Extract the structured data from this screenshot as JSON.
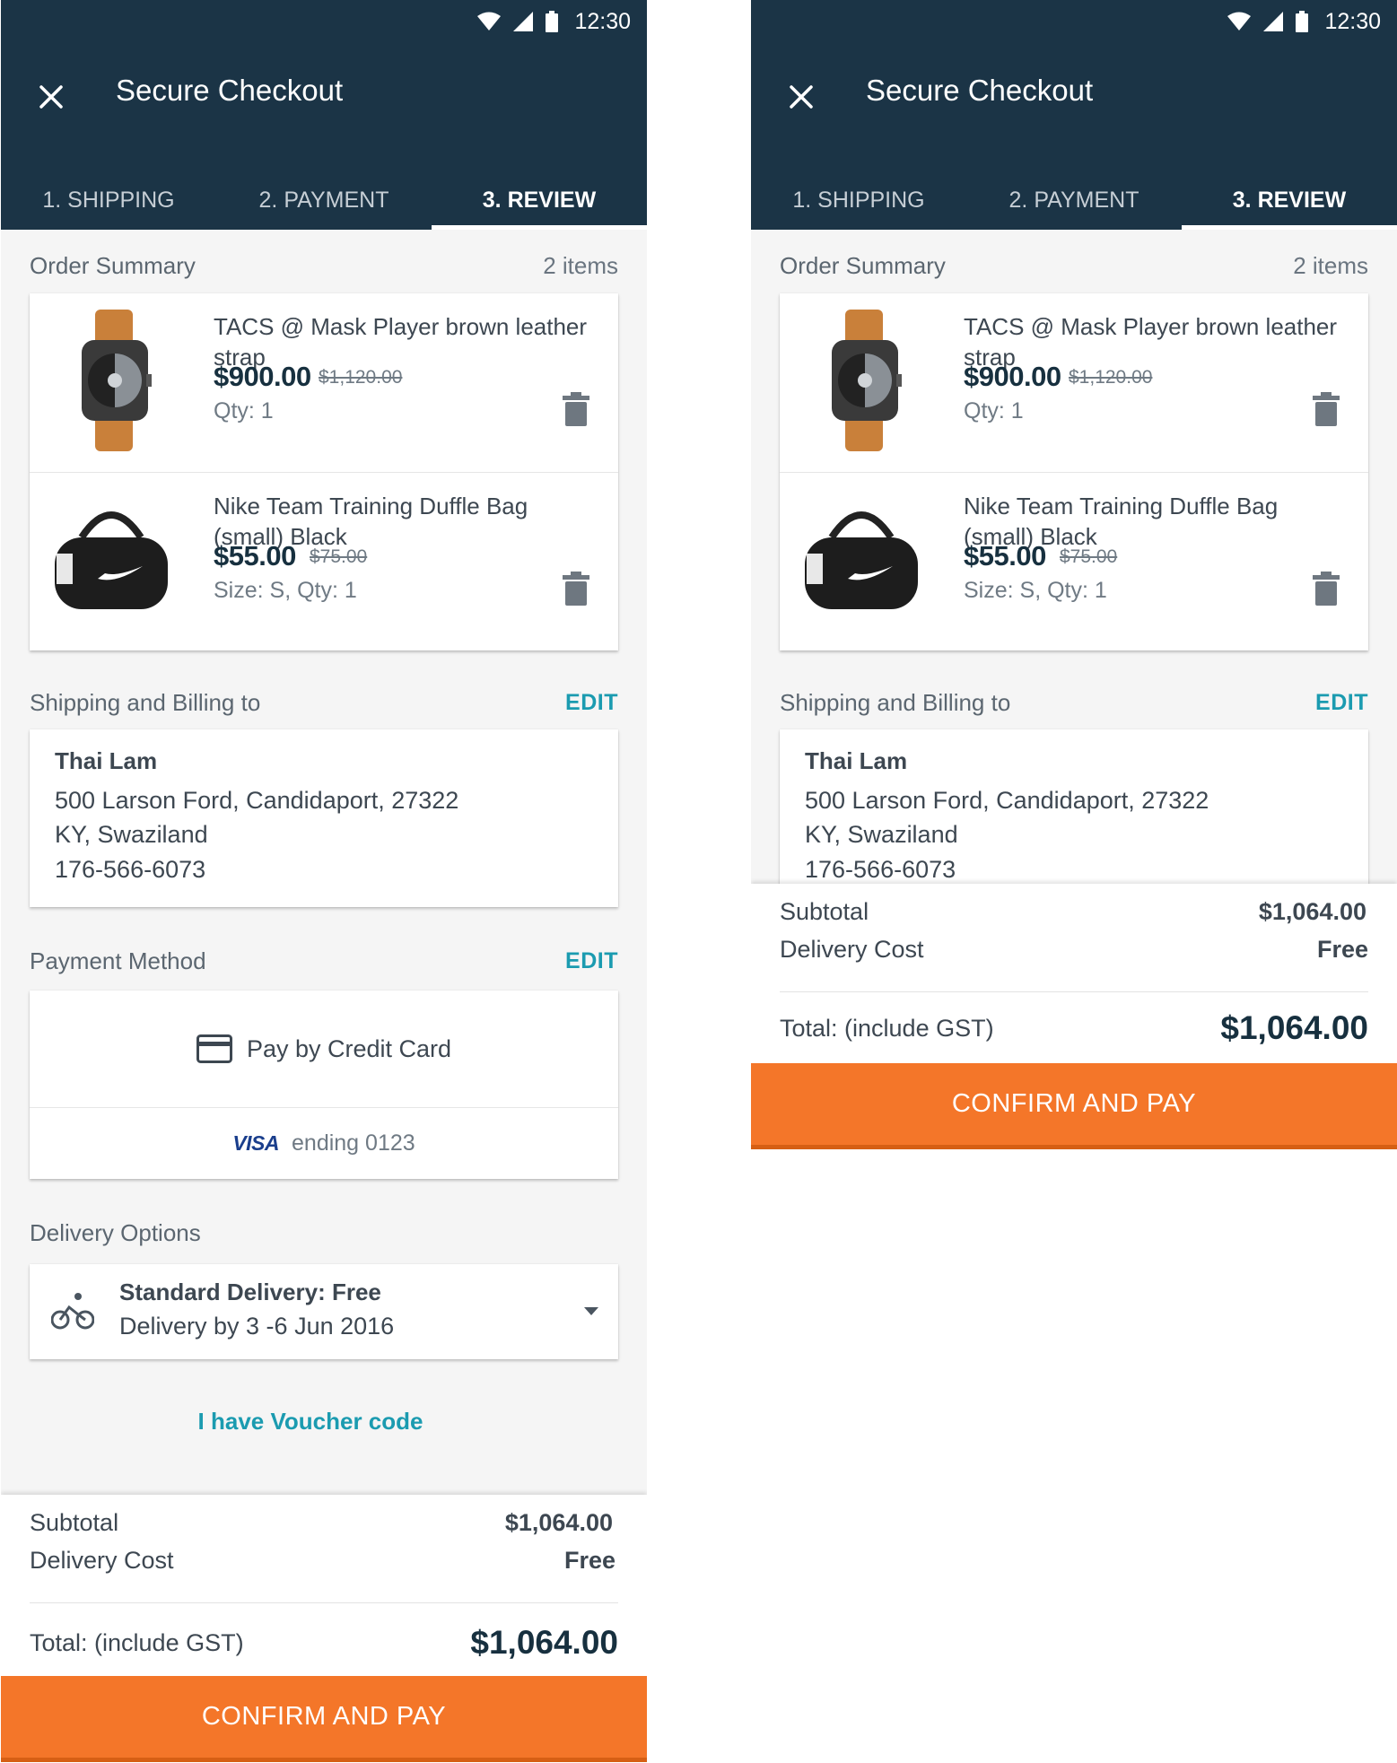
{
  "status_bar": {
    "time": "12:30"
  },
  "app_bar": {
    "title": "Secure Checkout"
  },
  "tabs": [
    {
      "label": "1. SHIPPING"
    },
    {
      "label": "2. PAYMENT"
    },
    {
      "label": "3. REVIEW",
      "active": true
    }
  ],
  "order_summary": {
    "title": "Order Summary",
    "count": "2 items",
    "items": [
      {
        "name": "TACS @ Mask Player brown leather strap",
        "price": "$900.00",
        "old_price": "$1,120.00",
        "details": "Qty: 1",
        "image_icon": "watch-image"
      },
      {
        "name": "Nike Team Training Duffle Bag (small) Black",
        "price": "$55.00",
        "old_price": "$75.00",
        "details": "Size: S, Qty: 1",
        "image_icon": "duffle-bag-image"
      }
    ]
  },
  "shipping": {
    "title": "Shipping and Billing to",
    "edit_label": "EDIT",
    "name": "Thai Lam",
    "line1": "500 Larson Ford,  Candidaport,  27322",
    "line2": "KY, Swaziland",
    "phone": "176-566-6073"
  },
  "payment": {
    "title": "Payment Method",
    "edit_label": "EDIT",
    "method": "Pay by Credit Card",
    "card_brand": "VISA",
    "card_ending": "ending 0123"
  },
  "delivery": {
    "title": "Delivery Options",
    "option": "Standard Delivery:  Free",
    "estimate": "Delivery by 3 -6 Jun 2016"
  },
  "voucher": {
    "label": "I have Voucher code"
  },
  "totals": {
    "subtotal_label": "Subtotal",
    "subtotal_value": "$1,064.00",
    "delivery_label": "Delivery Cost",
    "delivery_value": "Free",
    "total_label": "Total: (include GST)",
    "total_value": "$1,064.00"
  },
  "confirm_label": "CONFIRM AND PAY",
  "colors": {
    "header": "#1b3446",
    "accent_orange": "#f47629",
    "link_teal": "#1b9bb0"
  }
}
